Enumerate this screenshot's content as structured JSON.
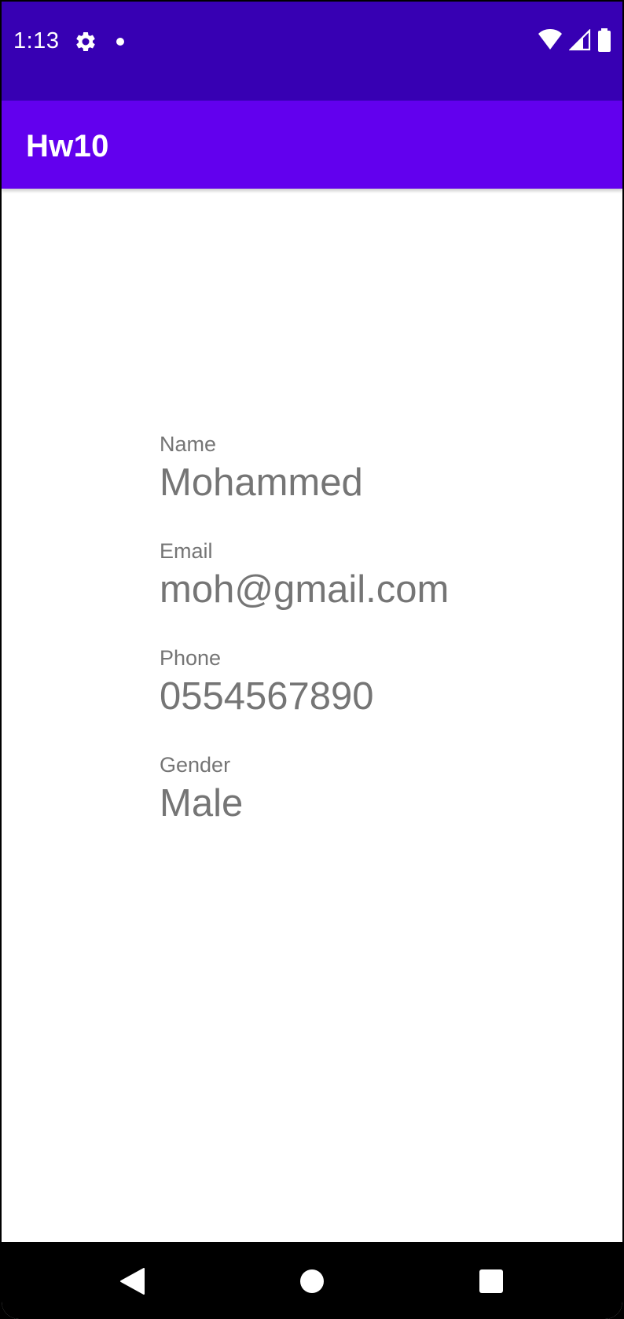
{
  "status_bar": {
    "time": "1:13",
    "icons": [
      "settings-gear-icon",
      "notification-dot-icon",
      "wifi-icon",
      "cellular-signal-icon",
      "battery-icon"
    ],
    "background_color": "#3700b3"
  },
  "app_bar": {
    "title": "Hw10",
    "background_color": "#6200ee"
  },
  "profile": {
    "fields": [
      {
        "label": "Name",
        "value": "Mohammed"
      },
      {
        "label": "Email",
        "value": "moh@gmail.com"
      },
      {
        "label": "Phone",
        "value": "0554567890"
      },
      {
        "label": "Gender",
        "value": "Male"
      }
    ],
    "text_color": "#757575"
  },
  "nav_bar": {
    "buttons": [
      "back-icon",
      "home-icon",
      "recents-icon"
    ]
  }
}
